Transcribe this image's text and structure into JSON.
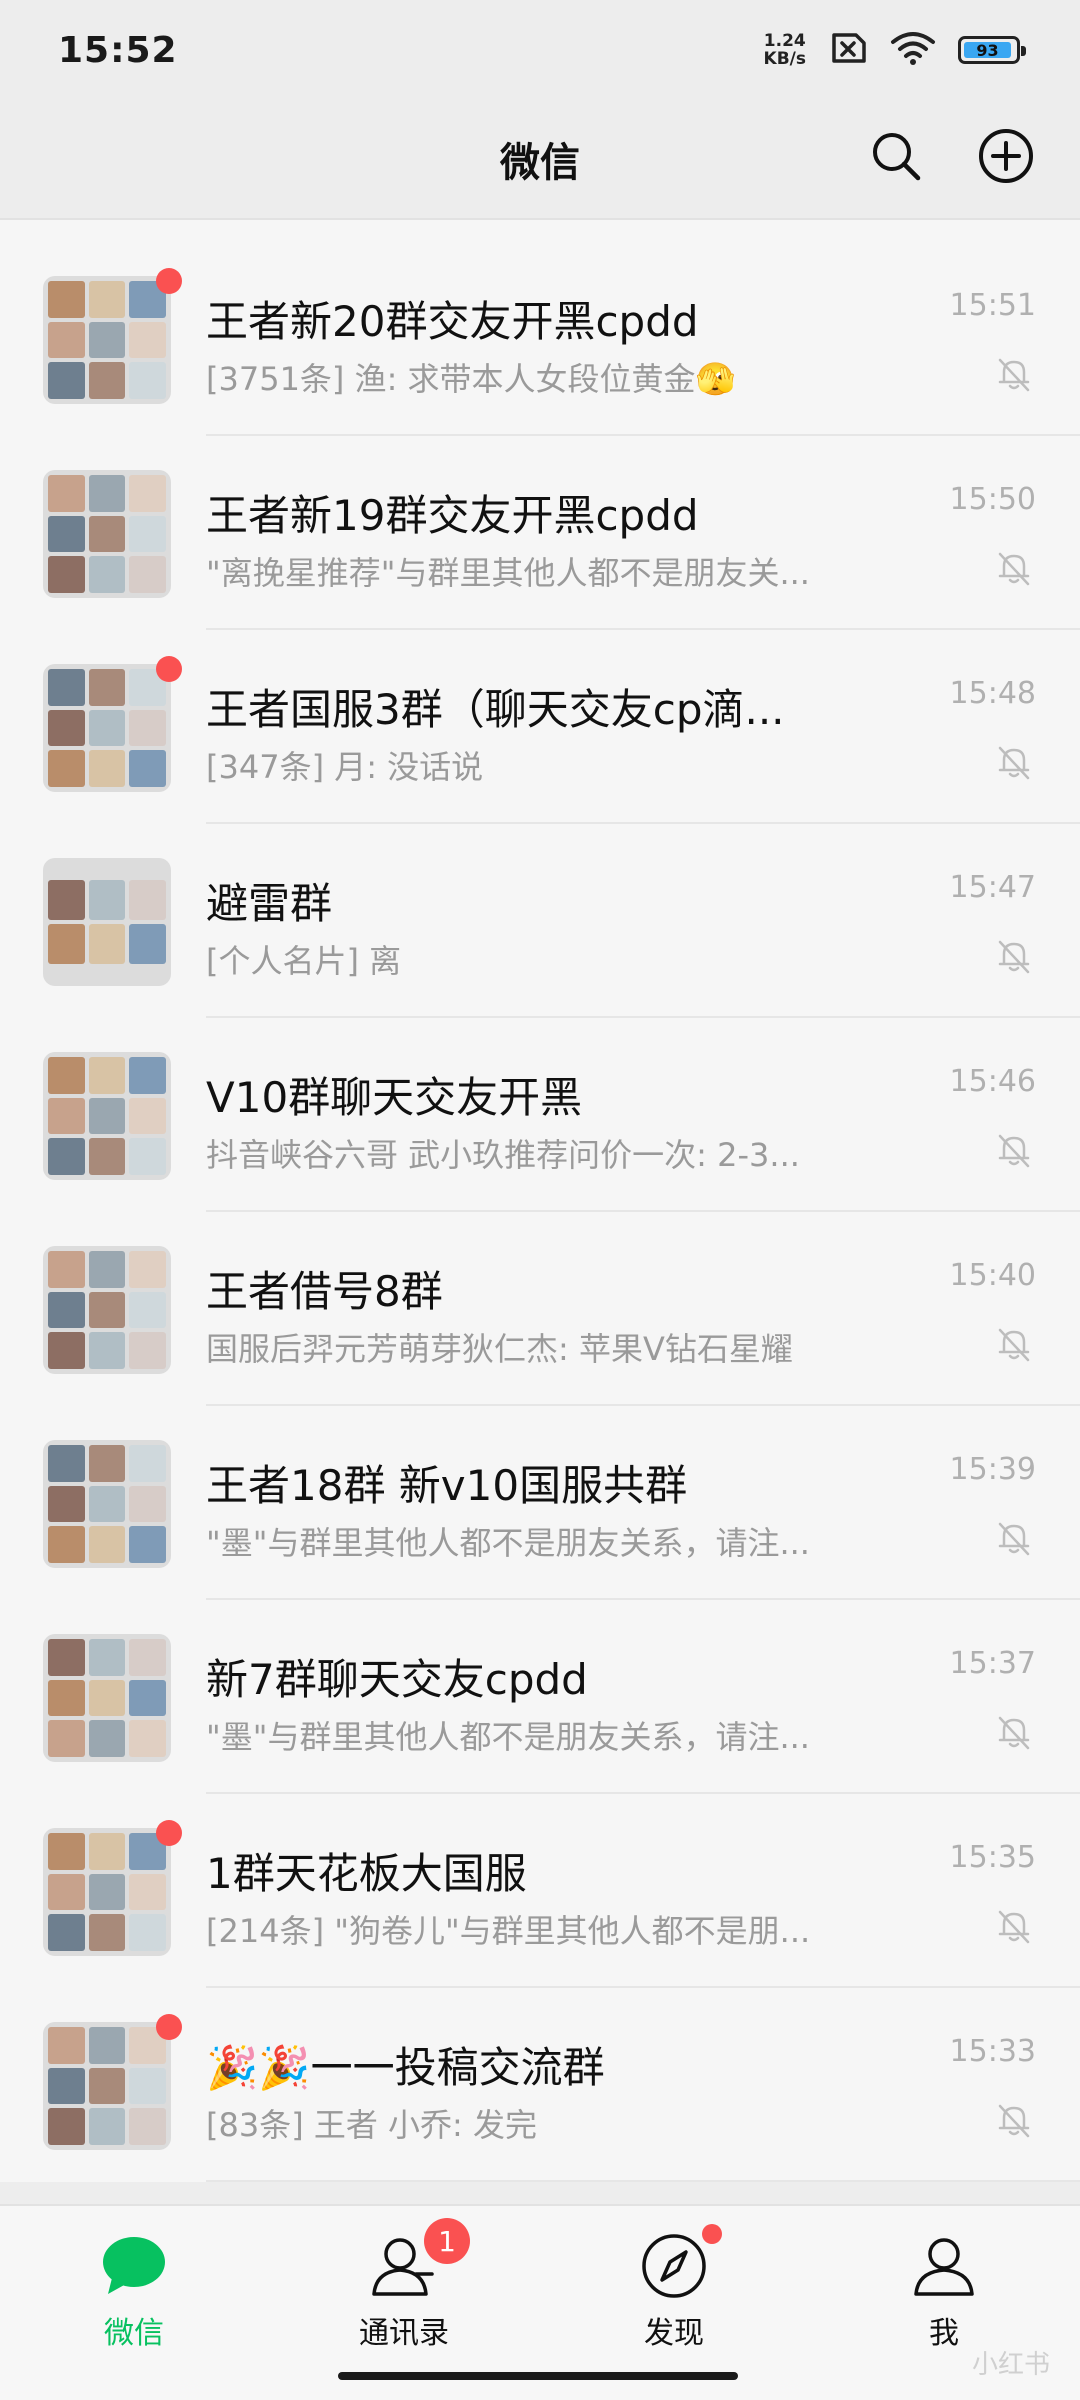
{
  "status_bar": {
    "time": "15:52",
    "net_speed_value": "1.24",
    "net_speed_unit": "KB/s",
    "battery": "93"
  },
  "header": {
    "title": "微信",
    "search_icon": "search-icon",
    "add_icon": "plus-circle-icon"
  },
  "chats": [
    {
      "title": "王者新20群交友开黑cpdd",
      "preview": "[3751条] 渔: 求带本人女段位黄金🫣",
      "time": "15:51",
      "unread": true,
      "avatar_rows": 3
    },
    {
      "title": "王者新19群交友开黑cpdd",
      "preview": "\"离挽星推荐\"与群里其他人都不是朋友关...",
      "time": "15:50",
      "unread": false,
      "avatar_rows": 3
    },
    {
      "title": "王者国服3群（聊天交友cp滴...",
      "preview": "[347条] 月: 没话说",
      "time": "15:48",
      "unread": true,
      "avatar_rows": 3
    },
    {
      "title": "避雷群",
      "preview": "[个人名片] 离",
      "time": "15:47",
      "unread": false,
      "avatar_rows": 2
    },
    {
      "title": "V10群聊天交友开黑",
      "preview": "抖音峡谷六哥 武小玖推荐问价一次: 2-3...",
      "time": "15:46",
      "unread": false,
      "avatar_rows": 3
    },
    {
      "title": "王者借号8群",
      "preview": "国服后羿元芳萌芽狄仁杰: 苹果V钻石星耀",
      "time": "15:40",
      "unread": false,
      "avatar_rows": 3
    },
    {
      "title": "王者18群 新v10国服共群",
      "preview": "\"墨\"与群里其他人都不是朋友关系，请注...",
      "time": "15:39",
      "unread": false,
      "avatar_rows": 3
    },
    {
      "title": "新7群聊天交友cpdd",
      "preview": "\"墨\"与群里其他人都不是朋友关系，请注...",
      "time": "15:37",
      "unread": false,
      "avatar_rows": 3
    },
    {
      "title": "1群天花板大国服",
      "preview": "[214条] \"狗卷儿\"与群里其他人都不是朋...",
      "time": "15:35",
      "unread": true,
      "avatar_rows": 3
    },
    {
      "title": "🎉🎉一一投稿交流群",
      "preview": "[83条] 王者 小乔: 发完",
      "time": "15:33",
      "unread": true,
      "avatar_rows": 3
    }
  ],
  "bottom_nav": {
    "tabs": [
      {
        "label": "微信",
        "icon": "chat-bubble-icon",
        "active": true
      },
      {
        "label": "通讯录",
        "icon": "contacts-icon",
        "badge": "1"
      },
      {
        "label": "发现",
        "icon": "compass-icon",
        "dot": true
      },
      {
        "label": "我",
        "icon": "person-icon"
      }
    ]
  },
  "watermark": "小红书",
  "colors": {
    "accent": "#07c160",
    "badge": "#fa5151",
    "background": "#ededed",
    "row_bg": "#f6f6f6"
  }
}
